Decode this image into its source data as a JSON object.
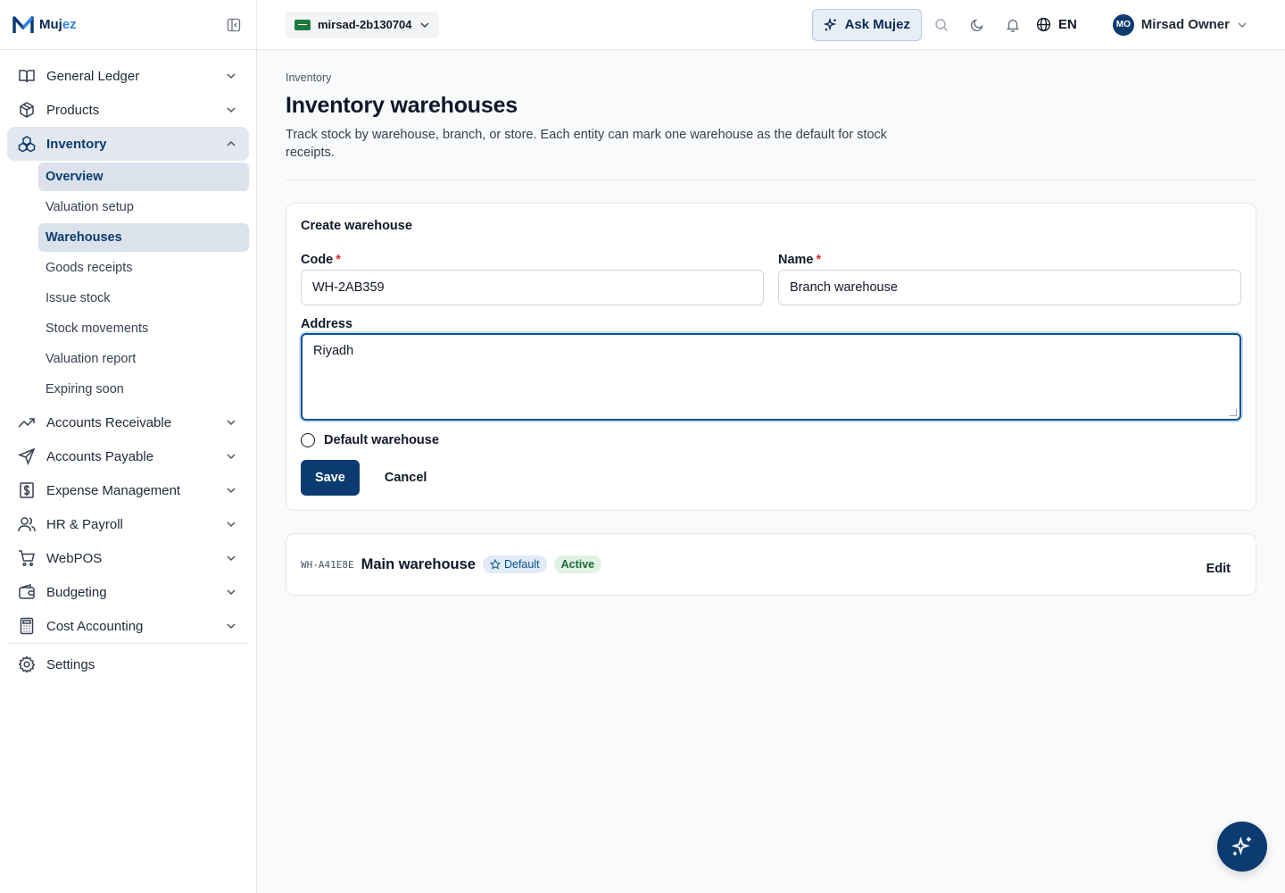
{
  "brand": {
    "name_part1": "Muj",
    "name_part2": "ez"
  },
  "topbar": {
    "org": "mirsad-2b130704",
    "ask_label": "Ask Mujez",
    "language": "EN",
    "user_initials": "MO",
    "user_name": "Mirsad Owner"
  },
  "sidebar": {
    "items": [
      {
        "label": "General Ledger",
        "icon": "book-open-icon"
      },
      {
        "label": "Products",
        "icon": "box-icon"
      },
      {
        "label": "Inventory",
        "icon": "boxes-icon"
      },
      {
        "label": "Accounts Receivable",
        "icon": "trending-up-icon"
      },
      {
        "label": "Accounts Payable",
        "icon": "send-icon"
      },
      {
        "label": "Expense Management",
        "icon": "receipt-dollar-icon"
      },
      {
        "label": "HR & Payroll",
        "icon": "users-icon"
      },
      {
        "label": "WebPOS",
        "icon": "shopping-cart-icon"
      },
      {
        "label": "Budgeting",
        "icon": "wallet-icon"
      },
      {
        "label": "Cost Accounting",
        "icon": "calculator-icon"
      }
    ],
    "inventory_sub": [
      "Overview",
      "Valuation setup",
      "Warehouses",
      "Goods receipts",
      "Issue stock",
      "Stock movements",
      "Valuation report",
      "Expiring soon"
    ],
    "settings": "Settings"
  },
  "page": {
    "breadcrumb": "Inventory",
    "title": "Inventory warehouses",
    "description": "Track stock by warehouse, branch, or store. Each entity can mark one warehouse as the default for stock receipts."
  },
  "form": {
    "title": "Create warehouse",
    "code_label": "Code",
    "code_value": "WH-2AB359",
    "name_label": "Name",
    "name_value": "Branch warehouse",
    "required_mark": "*",
    "address_label": "Address",
    "address_value": "Riyadh",
    "default_label": "Default warehouse",
    "default_checked": false,
    "save_label": "Save",
    "cancel_label": "Cancel"
  },
  "warehouses": [
    {
      "code": "WH-A41E8E",
      "name": "Main warehouse",
      "default_badge": "Default",
      "status_badge": "Active",
      "edit_label": "Edit"
    }
  ],
  "colors": {
    "primary": "#0b3b70",
    "accent": "#2f80ed",
    "required": "#dc2626",
    "active_badge_bg": "#e1f2e5"
  }
}
